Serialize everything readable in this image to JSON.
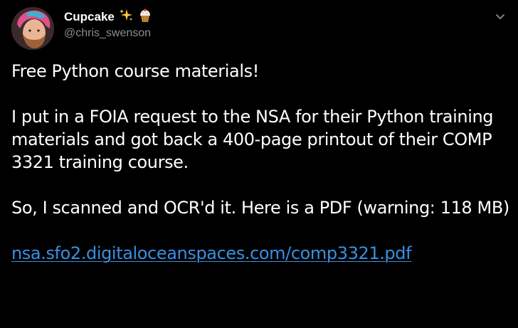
{
  "tweet": {
    "author": {
      "display_name": "Cupcake",
      "handle": "@chris_swenson"
    },
    "emojis": [
      "sparkles-icon",
      "cupcake-icon"
    ],
    "paragraphs": [
      "Free Python course materials!",
      "I put in a FOIA request to the NSA for their Python training materials and got back a 400-page printout of their COMP 3321 training course.",
      "So, I scanned and OCR'd it. Here is a PDF (warning: 118 MB)"
    ],
    "link_text": "nsa.sfo2.digitaloceanspaces.com/comp3321.pdf"
  },
  "colors": {
    "background": "#000000",
    "text": "#ffffff",
    "handle": "#8a8d91",
    "link": "#3a8fe0"
  },
  "icons": {
    "more_menu": "chevron-down-icon"
  }
}
